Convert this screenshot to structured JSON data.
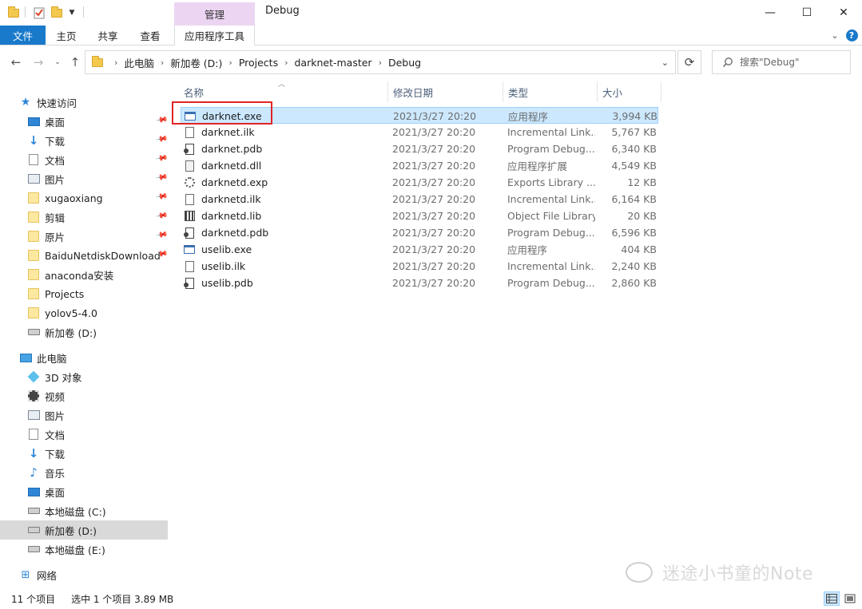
{
  "window": {
    "title": "Debug",
    "tool_tab_header": "管理",
    "minimize_glyph": "—",
    "maximize_glyph": "☐",
    "close_glyph": "✕"
  },
  "ribbon": {
    "tabs": [
      "文件",
      "主页",
      "共享",
      "查看",
      "应用程序工具"
    ],
    "accent_color": "#1979ca",
    "tool_tab_color": "#ecd5f3",
    "help_glyph": "?"
  },
  "address": {
    "crumbs": [
      "此电脑",
      "新加卷 (D:)",
      "Projects",
      "darknet-master",
      "Debug"
    ],
    "search_placeholder": "搜索\"Debug\""
  },
  "sidebar": {
    "quick_access": {
      "label": "快速访问",
      "items": [
        {
          "label": "桌面",
          "icon": "desktop-icon",
          "pinned": true
        },
        {
          "label": "下载",
          "icon": "download-icon",
          "pinned": true
        },
        {
          "label": "文档",
          "icon": "document-icon",
          "pinned": true
        },
        {
          "label": "图片",
          "icon": "picture-icon",
          "pinned": true
        },
        {
          "label": "xugaoxiang",
          "icon": "folder-icon",
          "pinned": true
        },
        {
          "label": "剪辑",
          "icon": "folder-icon",
          "pinned": true
        },
        {
          "label": "原片",
          "icon": "folder-icon",
          "pinned": true
        },
        {
          "label": "BaiduNetdiskDownload",
          "icon": "folder-icon",
          "pinned": true
        },
        {
          "label": "anaconda安装",
          "icon": "folder-icon",
          "pinned": false
        },
        {
          "label": "Projects",
          "icon": "folder-icon",
          "pinned": false
        },
        {
          "label": "yolov5-4.0",
          "icon": "folder-icon",
          "pinned": false
        },
        {
          "label": "新加卷 (D:)",
          "icon": "drive-icon",
          "pinned": false
        }
      ]
    },
    "this_pc": {
      "label": "此电脑",
      "items": [
        {
          "label": "3D 对象",
          "icon": "cube-icon"
        },
        {
          "label": "视频",
          "icon": "video-icon"
        },
        {
          "label": "图片",
          "icon": "picture-icon"
        },
        {
          "label": "文档",
          "icon": "document-icon"
        },
        {
          "label": "下载",
          "icon": "download-icon"
        },
        {
          "label": "音乐",
          "icon": "music-icon"
        },
        {
          "label": "桌面",
          "icon": "desktop-icon"
        },
        {
          "label": "本地磁盘 (C:)",
          "icon": "drive-icon"
        },
        {
          "label": "新加卷 (D:)",
          "icon": "drive-icon",
          "selected": true
        },
        {
          "label": "本地磁盘 (E:)",
          "icon": "drive-icon"
        }
      ]
    },
    "network": {
      "label": "网络",
      "icon": "network-icon"
    }
  },
  "columns": [
    "名称",
    "修改日期",
    "类型",
    "大小"
  ],
  "files": [
    {
      "name": "darknet.exe",
      "date": "2021/3/27 20:20",
      "type": "应用程序",
      "size": "3,994 KB",
      "icon": "exe",
      "selected": true
    },
    {
      "name": "darknet.ilk",
      "date": "2021/3/27 20:20",
      "type": "Incremental Link...",
      "size": "5,767 KB",
      "icon": "file"
    },
    {
      "name": "darknet.pdb",
      "date": "2021/3/27 20:20",
      "type": "Program Debug...",
      "size": "6,340 KB",
      "icon": "pdb"
    },
    {
      "name": "darknetd.dll",
      "date": "2021/3/27 20:20",
      "type": "应用程序扩展",
      "size": "4,549 KB",
      "icon": "dll"
    },
    {
      "name": "darknetd.exp",
      "date": "2021/3/27 20:20",
      "type": "Exports Library ...",
      "size": "12 KB",
      "icon": "gear"
    },
    {
      "name": "darknetd.ilk",
      "date": "2021/3/27 20:20",
      "type": "Incremental Link...",
      "size": "6,164 KB",
      "icon": "file"
    },
    {
      "name": "darknetd.lib",
      "date": "2021/3/27 20:20",
      "type": "Object File Library",
      "size": "20 KB",
      "icon": "lib"
    },
    {
      "name": "darknetd.pdb",
      "date": "2021/3/27 20:20",
      "type": "Program Debug...",
      "size": "6,596 KB",
      "icon": "pdb"
    },
    {
      "name": "uselib.exe",
      "date": "2021/3/27 20:20",
      "type": "应用程序",
      "size": "404 KB",
      "icon": "exe"
    },
    {
      "name": "uselib.ilk",
      "date": "2021/3/27 20:20",
      "type": "Incremental Link...",
      "size": "2,240 KB",
      "icon": "file"
    },
    {
      "name": "uselib.pdb",
      "date": "2021/3/27 20:20",
      "type": "Program Debug...",
      "size": "2,860 KB",
      "icon": "pdb"
    }
  ],
  "status": {
    "item_count": "11 个项目",
    "selection": "选中 1 个项目  3.89 MB"
  },
  "watermark": "迷途小书童的Note",
  "colors": {
    "selection_bg": "#cce8ff",
    "selection_border": "#99d1ff",
    "annotation_box": "#e02424"
  }
}
